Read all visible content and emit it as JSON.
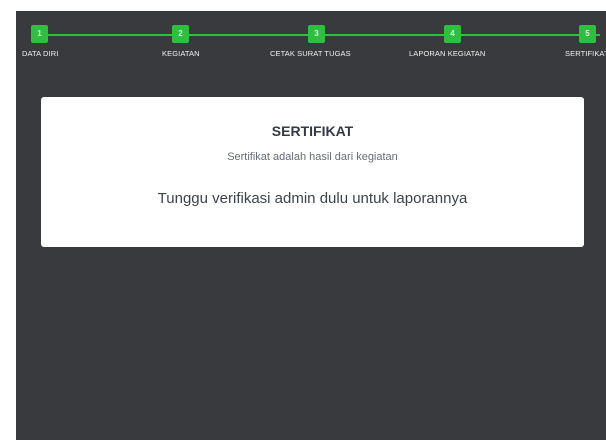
{
  "stepper": {
    "steps": [
      {
        "number": "1",
        "label": "DATA DIRI"
      },
      {
        "number": "2",
        "label": "KEGIATAN"
      },
      {
        "number": "3",
        "label": "CETAK SURAT TUGAS"
      },
      {
        "number": "4",
        "label": "LAPORAN KEGIATAN"
      },
      {
        "number": "5",
        "label": "SERTIFIKAT"
      }
    ],
    "active_color": "#2fbf3f"
  },
  "card": {
    "title": "SERTIFIKAT",
    "subtitle": "Sertifikat adalah hasil dari kegiatan",
    "message": "Tunggu verifikasi admin dulu untuk laporannya"
  },
  "colors": {
    "background": "#383a3d",
    "card": "#ffffff"
  }
}
